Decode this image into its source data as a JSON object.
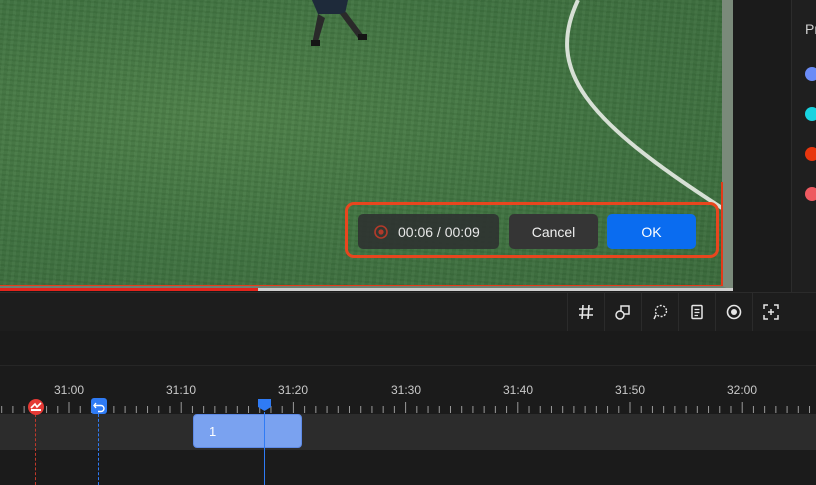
{
  "player": {
    "time_display": "00:06 / 00:09",
    "progress": 0.352
  },
  "buttons": {
    "cancel": "Cancel",
    "ok": "OK"
  },
  "right_panel": {
    "title_partial": "Pr",
    "swatches": [
      "#6b8cf7",
      "#19d3e0",
      "#e8360e",
      "#ee5a61"
    ]
  },
  "toolbar": {
    "tools": [
      "grid-icon",
      "shape-icon",
      "lasso-icon",
      "notes-icon",
      "target-icon",
      "crop-add-icon"
    ]
  },
  "timeline": {
    "tick_labels": [
      "31:00",
      "31:10",
      "31:20",
      "31:30",
      "31:40",
      "31:50",
      "32:00"
    ],
    "clip_label": "1",
    "colors": {
      "playhead": "#2f7bf5",
      "clip": "#7aa2f0",
      "marker_red": "#e53935",
      "marker_blue": "#2f7bf5"
    }
  },
  "colors": {
    "accent": "#0a6cf0",
    "highlight": "#e8461e",
    "progress": "#e4241c"
  }
}
